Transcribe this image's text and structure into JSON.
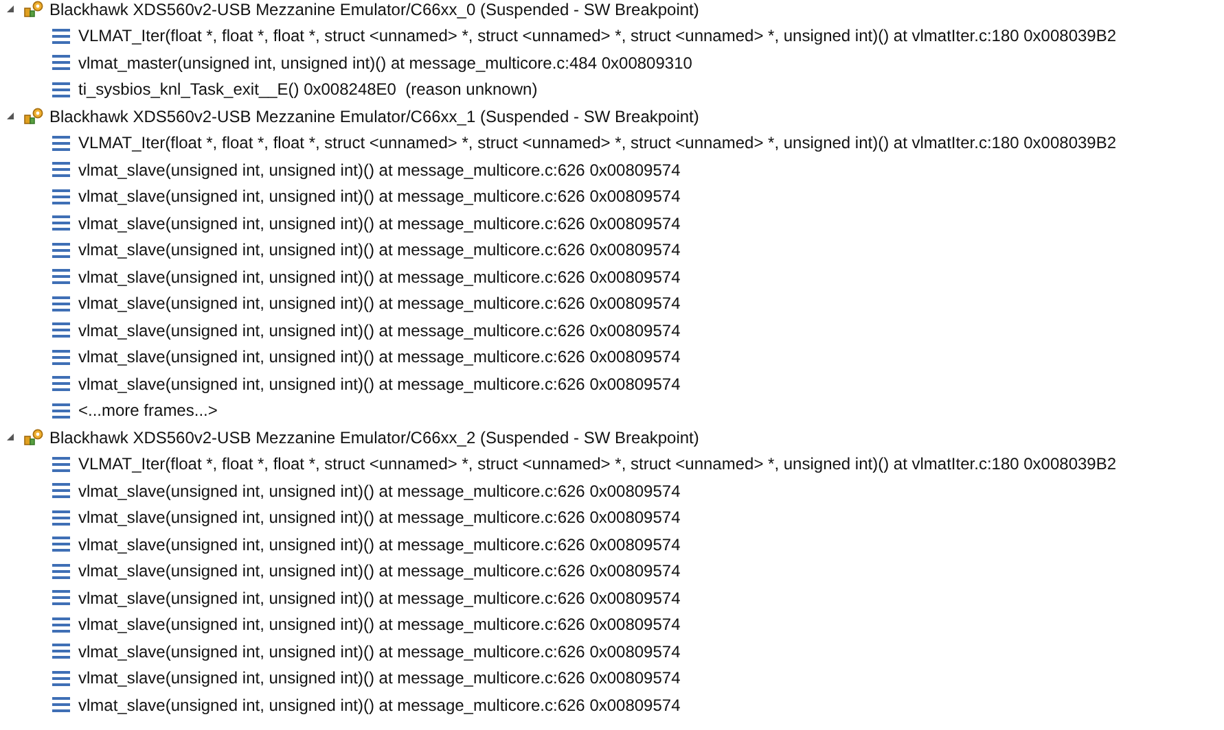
{
  "debug_tree": [
    {
      "label": "Blackhawk XDS560v2-USB Mezzanine Emulator/C66xx_0 (Suspended - SW Breakpoint)",
      "expanded": true,
      "children": [
        {
          "label": "VLMAT_Iter(float *, float *, float *, struct <unnamed> *, struct <unnamed> *, struct <unnamed> *, unsigned int)() at vlmatIter.c:180 0x008039B2"
        },
        {
          "label": "vlmat_master(unsigned int, unsigned int)() at message_multicore.c:484 0x00809310"
        },
        {
          "label": "ti_sysbios_knl_Task_exit__E() 0x008248E0  (reason unknown)"
        }
      ]
    },
    {
      "label": "Blackhawk XDS560v2-USB Mezzanine Emulator/C66xx_1 (Suspended - SW Breakpoint)",
      "expanded": true,
      "children": [
        {
          "label": "VLMAT_Iter(float *, float *, float *, struct <unnamed> *, struct <unnamed> *, struct <unnamed> *, unsigned int)() at vlmatIter.c:180 0x008039B2"
        },
        {
          "label": "vlmat_slave(unsigned int, unsigned int)() at message_multicore.c:626 0x00809574"
        },
        {
          "label": "vlmat_slave(unsigned int, unsigned int)() at message_multicore.c:626 0x00809574"
        },
        {
          "label": "vlmat_slave(unsigned int, unsigned int)() at message_multicore.c:626 0x00809574"
        },
        {
          "label": "vlmat_slave(unsigned int, unsigned int)() at message_multicore.c:626 0x00809574"
        },
        {
          "label": "vlmat_slave(unsigned int, unsigned int)() at message_multicore.c:626 0x00809574"
        },
        {
          "label": "vlmat_slave(unsigned int, unsigned int)() at message_multicore.c:626 0x00809574"
        },
        {
          "label": "vlmat_slave(unsigned int, unsigned int)() at message_multicore.c:626 0x00809574"
        },
        {
          "label": "vlmat_slave(unsigned int, unsigned int)() at message_multicore.c:626 0x00809574"
        },
        {
          "label": "vlmat_slave(unsigned int, unsigned int)() at message_multicore.c:626 0x00809574"
        },
        {
          "label": "<...more frames...>"
        }
      ]
    },
    {
      "label": "Blackhawk XDS560v2-USB Mezzanine Emulator/C66xx_2 (Suspended - SW Breakpoint)",
      "expanded": true,
      "children": [
        {
          "label": "VLMAT_Iter(float *, float *, float *, struct <unnamed> *, struct <unnamed> *, struct <unnamed> *, unsigned int)() at vlmatIter.c:180 0x008039B2"
        },
        {
          "label": "vlmat_slave(unsigned int, unsigned int)() at message_multicore.c:626 0x00809574"
        },
        {
          "label": "vlmat_slave(unsigned int, unsigned int)() at message_multicore.c:626 0x00809574"
        },
        {
          "label": "vlmat_slave(unsigned int, unsigned int)() at message_multicore.c:626 0x00809574"
        },
        {
          "label": "vlmat_slave(unsigned int, unsigned int)() at message_multicore.c:626 0x00809574"
        },
        {
          "label": "vlmat_slave(unsigned int, unsigned int)() at message_multicore.c:626 0x00809574"
        },
        {
          "label": "vlmat_slave(unsigned int, unsigned int)() at message_multicore.c:626 0x00809574"
        },
        {
          "label": "vlmat_slave(unsigned int, unsigned int)() at message_multicore.c:626 0x00809574"
        },
        {
          "label": "vlmat_slave(unsigned int, unsigned int)() at message_multicore.c:626 0x00809574"
        },
        {
          "label": "vlmat_slave(unsigned int, unsigned int)() at message_multicore.c:626 0x00809574"
        }
      ]
    }
  ]
}
